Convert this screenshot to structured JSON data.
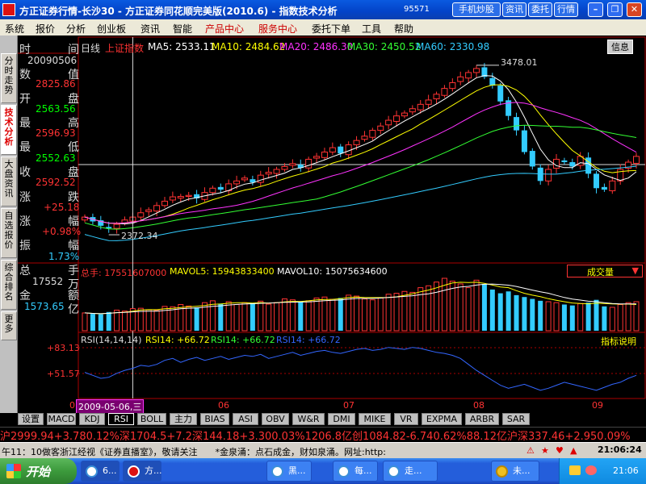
{
  "title": {
    "text": "方正证券行情-长沙30 - 方正证券同花顺完美版(2010.6) - 指数技术分析",
    "num": "95571",
    "btn_phone": "手机炒股",
    "btn_news": "资讯",
    "btn_commission": "委托",
    "btn_quote": "行情"
  },
  "menu": [
    "系统",
    "报价",
    "分析",
    "创业板",
    "资讯",
    "智能",
    "产品中心",
    "服务中心",
    "委托下单",
    "工具",
    "帮助"
  ],
  "left_tabs": [
    "分时走势",
    "技术分析",
    "大盘资讯",
    "自选报价",
    "综合排名",
    "更多"
  ],
  "header": {
    "period": "日线",
    "index_name": "上证指数",
    "ma5": "MA5: 2533.11",
    "ma10": "MA10: 2484.62",
    "ma20": "MA20: 2486.30",
    "ma30": "MA30: 2450.52",
    "ma60": "MA60: 2330.98",
    "info": "信息"
  },
  "info_panel": {
    "time_label": "时",
    "time_label2": "间",
    "date": "20090506",
    "value_label": "数",
    "value_label2": "值",
    "value": "2825.86",
    "open_label": "开",
    "open_label2": "盘",
    "open": "2563.56",
    "high_label": "最",
    "high_label2": "高",
    "high": "2596.93",
    "low_label": "最",
    "low_label2": "低",
    "low": "2552.63",
    "close_label": "收",
    "close_label2": "盘",
    "close": "2592.52",
    "change_label": "涨",
    "change_label2": "跌",
    "change": "+25.18",
    "pct_label": "涨",
    "pct_label2": "幅",
    "pct": "+0.98%",
    "amp_label": "振",
    "amp_label2": "幅",
    "amp": "1.73%",
    "vol_label": "总",
    "vol_label2": "手",
    "vol": "17552",
    "vol_unit": "万",
    "amt_label": "金",
    "amt_label2": "额",
    "amt": "1573.65",
    "amt_unit": "亿"
  },
  "annotations": {
    "high": "3478.01",
    "low": "2372.34"
  },
  "volume_header": {
    "total": "总手: 17551607000",
    "mavol5": "MAVOL5: 15943833400",
    "mavol10": "MAVOL10: 15075634600",
    "dropdown": "成交量"
  },
  "rsi_header": {
    "name": "RSI(14,14,14)",
    "rsi1": "RSI14: +66.72",
    "rsi2": "RSI14: +66.72",
    "rsi3": "RSI14: +66.72",
    "explain": "指标说明"
  },
  "rsi_axis": {
    "upper": "+83.13",
    "lower": "+51.57"
  },
  "xaxis": {
    "zero": "0",
    "cursor": "2009-05-06,三",
    "m06": "06",
    "m07": "07",
    "m08": "08",
    "m09": "09"
  },
  "bottom_tabs": [
    "设置",
    "MACD",
    "KDJ",
    "RSI",
    "BOLL",
    "主力",
    "BIAS",
    "ASI",
    "OBV",
    "W&R",
    "DMI",
    "MIKE",
    "VR",
    "EXPMA",
    "ARBR",
    "SAR"
  ],
  "ticker1": "沪2999.94+3.780.12%深1704.5+7.2深144.18+3.300.03%1206.8亿创1084.82-6.740.62%88.12亿沪深337.46+2.950.09%",
  "ticker2": "午11：10做客浙江经视《证券直播室》，敬请关注　　*金泉涌：点石成金，财如泉涌。网址:http:",
  "clock_status": "21:06:24",
  "taskbar": {
    "start": "开始",
    "tasks": [
      "6...",
      "方...",
      "黑...",
      "每...",
      "走...",
      "未..."
    ],
    "time": "21:06"
  },
  "chart_data": {
    "type": "candlestick",
    "title": "上证指数 日线",
    "x_range": [
      "2009-04-21",
      "2009-09-30"
    ],
    "ylim": [
      2300,
      3550
    ],
    "annotated_high": 3478.01,
    "annotated_low": 2372.34,
    "cursor_date": "2009-05-06",
    "ma": {
      "MA5": 2533.11,
      "MA10": 2484.62,
      "MA20": 2486.3,
      "MA30": 2450.52,
      "MA60": 2330.98
    },
    "close_path": [
      2450,
      2420,
      2390,
      2372,
      2400,
      2430,
      2450,
      2480,
      2500,
      2530,
      2560,
      2590,
      2593,
      2600,
      2580,
      2620,
      2650,
      2640,
      2680,
      2700,
      2720,
      2690,
      2740,
      2760,
      2780,
      2800,
      2820,
      2790,
      2850,
      2870,
      2900,
      2930,
      2890,
      2950,
      2980,
      3010,
      3050,
      3080,
      3120,
      3150,
      3170,
      3200,
      3230,
      3260,
      3300,
      3340,
      3380,
      3420,
      3450,
      3478,
      3420,
      3360,
      3250,
      3150,
      3050,
      2900,
      2800,
      2700,
      2780,
      2850,
      2830,
      2800,
      2870,
      2750,
      2650,
      2640,
      2700,
      2780,
      2830,
      2870
    ],
    "volume": [
      95,
      90,
      88,
      100,
      110,
      105,
      118,
      120,
      112,
      108,
      130,
      128,
      140,
      132,
      125,
      150,
      160,
      145,
      155,
      140,
      150,
      148,
      158,
      142,
      150,
      170,
      165,
      155,
      160,
      175,
      180,
      168,
      175,
      190,
      185,
      170,
      165,
      175,
      195,
      200,
      210,
      205,
      230,
      240,
      260,
      280,
      265,
      250,
      230,
      270,
      250,
      220,
      200,
      210,
      190,
      180,
      170,
      160,
      155,
      150,
      140,
      135,
      145,
      150,
      165,
      130,
      125,
      140,
      150,
      155
    ],
    "rsi": [
      58,
      55,
      52,
      53,
      57,
      60,
      62,
      65,
      64,
      66,
      70,
      72,
      68,
      71,
      73,
      70,
      72,
      74,
      71,
      73,
      75,
      74,
      76,
      72,
      74,
      76,
      78,
      75,
      77,
      79,
      80,
      78,
      77,
      79,
      81,
      82,
      80,
      81,
      83,
      82,
      81,
      83,
      82,
      80,
      78,
      77,
      75,
      72,
      66,
      60,
      55,
      50,
      45,
      42,
      44,
      46,
      43,
      40,
      42,
      45,
      48,
      46,
      44,
      42,
      40,
      43,
      46,
      48,
      52,
      55
    ],
    "volume_unit": "万手",
    "rsi_ylim": [
      35,
      90
    ]
  }
}
